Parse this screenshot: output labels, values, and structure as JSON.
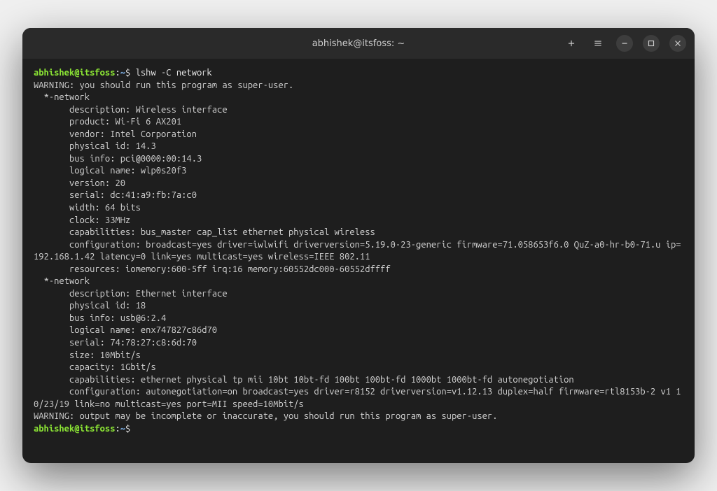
{
  "window": {
    "title": "abhishek@itsfoss: ~"
  },
  "prompt": {
    "userhost": "abhishek@itsfoss",
    "sep": ":",
    "path": "~",
    "symbol": "$"
  },
  "command1": "lshw -C network",
  "output": {
    "l1": "WARNING: you should run this program as super-user.",
    "l2": "  *-network",
    "l3": "       description: Wireless interface",
    "l4": "       product: Wi-Fi 6 AX201",
    "l5": "       vendor: Intel Corporation",
    "l6": "       physical id: 14.3",
    "l7": "       bus info: pci@0000:00:14.3",
    "l8": "       logical name: wlp0s20f3",
    "l9": "       version: 20",
    "l10": "       serial: dc:41:a9:fb:7a:c0",
    "l11": "       width: 64 bits",
    "l12": "       clock: 33MHz",
    "l13": "       capabilities: bus_master cap_list ethernet physical wireless",
    "l14": "       configuration: broadcast=yes driver=iwlwifi driverversion=5.19.0-23-generic firmware=71.058653f6.0 QuZ-a0-hr-b0-71.u ip=192.168.1.42 latency=0 link=yes multicast=yes wireless=IEEE 802.11",
    "l15": "       resources: iomemory:600-5ff irq:16 memory:60552dc000-60552dffff",
    "l16": "  *-network",
    "l17": "       description: Ethernet interface",
    "l18": "       physical id: 18",
    "l19": "       bus info: usb@6:2.4",
    "l20": "       logical name: enx747827c86d70",
    "l21": "       serial: 74:78:27:c8:6d:70",
    "l22": "       size: 10Mbit/s",
    "l23": "       capacity: 1Gbit/s",
    "l24": "       capabilities: ethernet physical tp mii 10bt 10bt-fd 100bt 100bt-fd 1000bt 1000bt-fd autonegotiation",
    "l25": "       configuration: autonegotiation=on broadcast=yes driver=r8152 driverversion=v1.12.13 duplex=half firmware=rtl8153b-2 v1 10/23/19 link=no multicast=yes port=MII speed=10Mbit/s",
    "l26": "WARNING: output may be incomplete or inaccurate, you should run this program as super-user."
  },
  "command2": ""
}
